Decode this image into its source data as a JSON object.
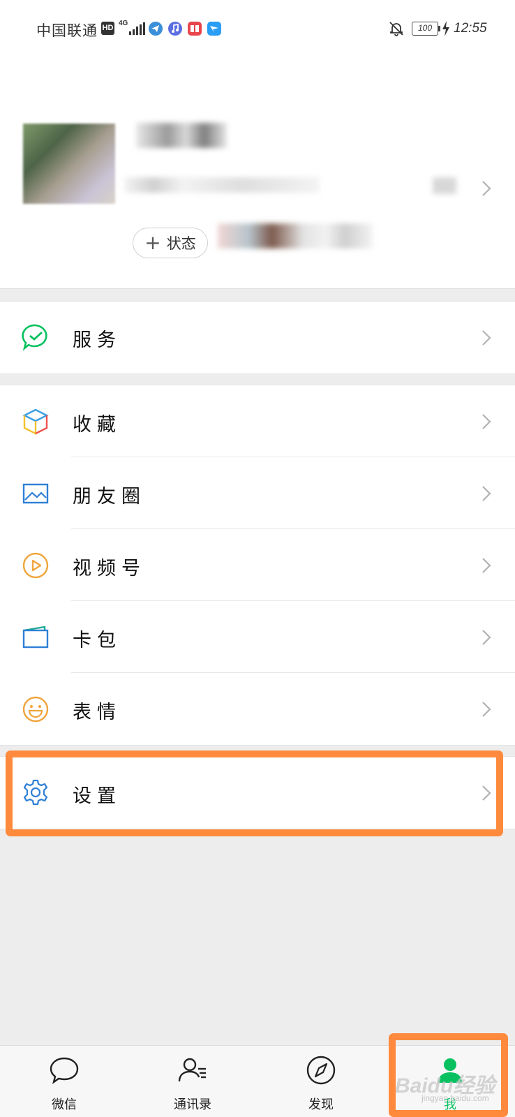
{
  "status_bar": {
    "carrier": "中国联通",
    "hd_label": "HD",
    "network": "4G",
    "battery": "100",
    "time": "12:55"
  },
  "profile": {
    "status_button": "状态"
  },
  "menu": {
    "service": "服务",
    "favorites": "收藏",
    "moments": "朋友圈",
    "channels": "视频号",
    "cards": "卡包",
    "stickers": "表情",
    "settings": "设置"
  },
  "tabs": [
    {
      "label": "微信",
      "icon": "chat-bubble-icon",
      "active": false
    },
    {
      "label": "通讯录",
      "icon": "contacts-icon",
      "active": false
    },
    {
      "label": "发现",
      "icon": "compass-icon",
      "active": false
    },
    {
      "label": "我",
      "icon": "person-icon",
      "active": true
    }
  ],
  "watermark": {
    "text": "Baidu经验",
    "sub": "jingyan.baidu.com"
  },
  "colors": {
    "accent_green": "#07c160",
    "highlight_orange": "#ff8a3d",
    "background": "#ededed"
  }
}
